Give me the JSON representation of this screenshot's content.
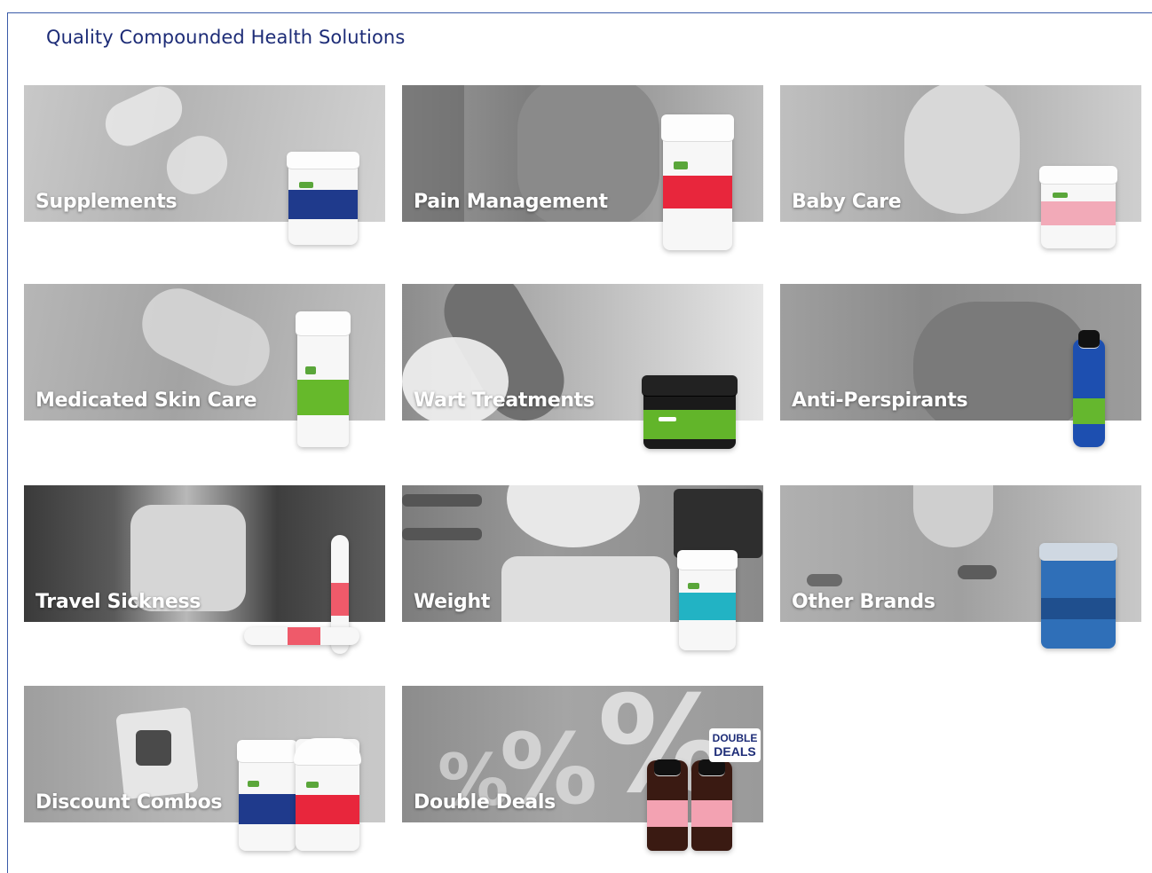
{
  "page": {
    "heading": "Quality Compounded Health Solutions"
  },
  "colors": {
    "heading": "#1d2c77",
    "border": "#3a5ba8",
    "label": "#ffffff",
    "brand_green": "#5aa63a"
  },
  "categories": [
    {
      "label": "Supplements",
      "icon": "supplements-product-jar"
    },
    {
      "label": "Pain Management",
      "icon": "pain-management-product-bottle"
    },
    {
      "label": "Baby Care",
      "icon": "baby-care-product-jar"
    },
    {
      "label": "Medicated Skin Care",
      "icon": "skin-care-product-tube"
    },
    {
      "label": "Wart Treatments",
      "icon": "wart-treatment-product-jar"
    },
    {
      "label": "Anti-Perspirants",
      "icon": "anti-perspirant-spray-bottle"
    },
    {
      "label": "Travel Sickness",
      "icon": "travel-sickness-product-tube"
    },
    {
      "label": "Weight",
      "icon": "weight-product-bottle"
    },
    {
      "label": "Other Brands",
      "icon": "other-brands-product-jar"
    },
    {
      "label": "Discount Combos",
      "icon": "discount-combos-product-bottles"
    },
    {
      "label": "Double Deals",
      "icon": "double-deals-product-bottles"
    }
  ],
  "badges": {
    "double_deals_line1": "DOUBLE",
    "double_deals_line2": "DEALS"
  }
}
